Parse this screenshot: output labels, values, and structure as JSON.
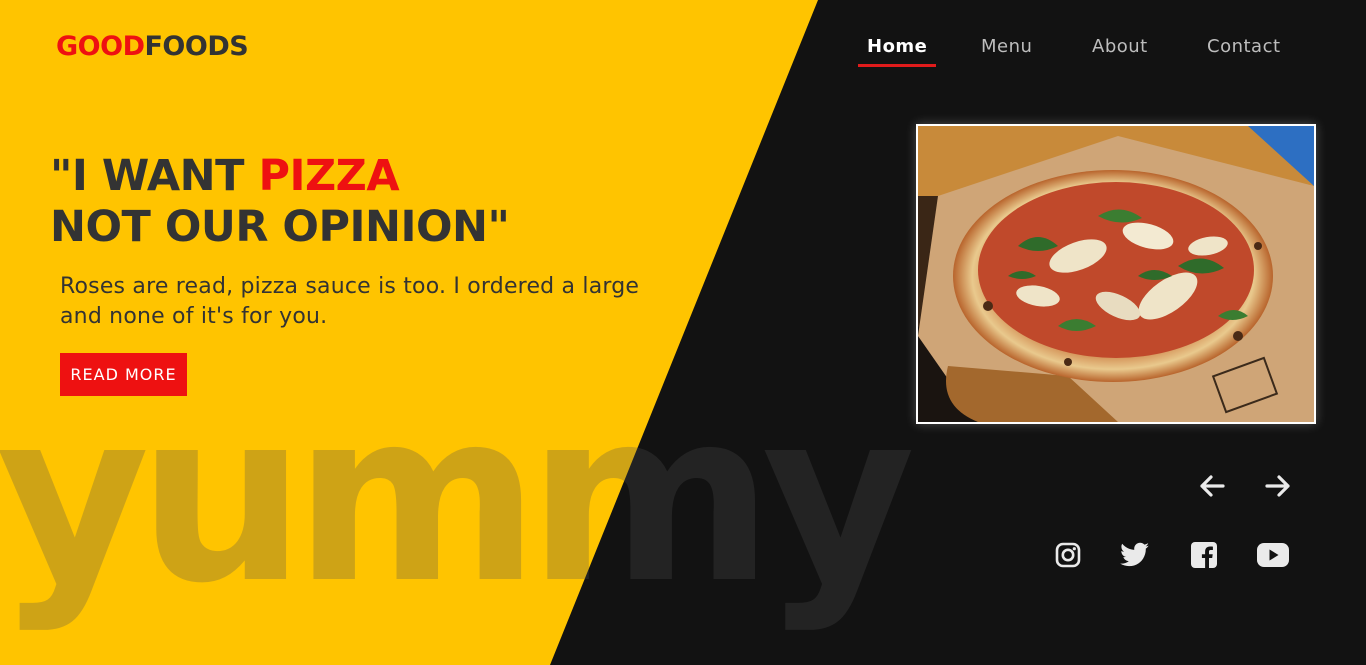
{
  "brand": {
    "part1": "GOOD",
    "part2": "FOODS"
  },
  "nav": {
    "items": [
      {
        "label": "Home",
        "active": true
      },
      {
        "label": "Menu",
        "active": false
      },
      {
        "label": "About",
        "active": false
      },
      {
        "label": "Contact",
        "active": false
      }
    ]
  },
  "hero": {
    "line1_prefix": "\"I WANT ",
    "line1_highlight": "PIZZA",
    "line2": "NOT OUR OPINION\"",
    "description": "Roses are read, pizza sauce is too. I ordered a large and none of it's for you.",
    "button_label": "READ MORE",
    "watermark": "yummy"
  },
  "carousel": {
    "prev_icon": "arrow-left-icon",
    "next_icon": "arrow-right-icon"
  },
  "socials": [
    "instagram-icon",
    "twitter-icon",
    "facebook-icon",
    "youtube-icon"
  ],
  "colors": {
    "accent_yellow": "#ffc400",
    "accent_red": "#ee1111",
    "dark_bg": "#121212",
    "text_dark": "#333333"
  }
}
